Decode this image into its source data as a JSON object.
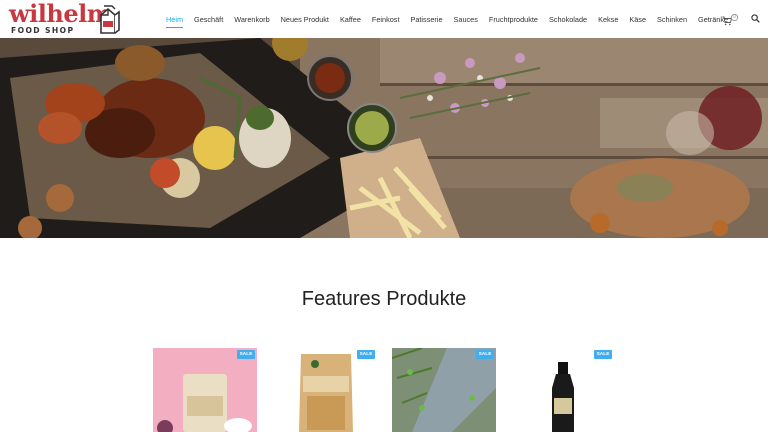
{
  "logo": {
    "word": "wilhelm",
    "sub": "FOOD SHOP"
  },
  "nav": [
    {
      "label": "Heim",
      "active": true
    },
    {
      "label": "Geschäft"
    },
    {
      "label": "Warenkorb"
    },
    {
      "label": "Neues Produkt"
    },
    {
      "label": "Kaffee"
    },
    {
      "label": "Feinkost"
    },
    {
      "label": "Patisserie"
    },
    {
      "label": "Sauces"
    },
    {
      "label": "Fruchtprodukte"
    },
    {
      "label": "Schokolade"
    },
    {
      "label": "Kekse"
    },
    {
      "label": "Käse"
    },
    {
      "label": "Schinken"
    },
    {
      "label": "Getränke"
    }
  ],
  "cart": {
    "count": "0",
    "icon": "cart-icon"
  },
  "search": {
    "icon": "search-icon"
  },
  "section": {
    "title": "Features Produkte"
  },
  "products": [
    {
      "badge": "SALE"
    },
    {
      "badge": "SALE"
    },
    {
      "badge": "SALE"
    },
    {
      "badge": "SALE"
    }
  ],
  "colors": {
    "brand": "#c9373f",
    "accent": "#13aff0",
    "sale": "#3faef0"
  }
}
